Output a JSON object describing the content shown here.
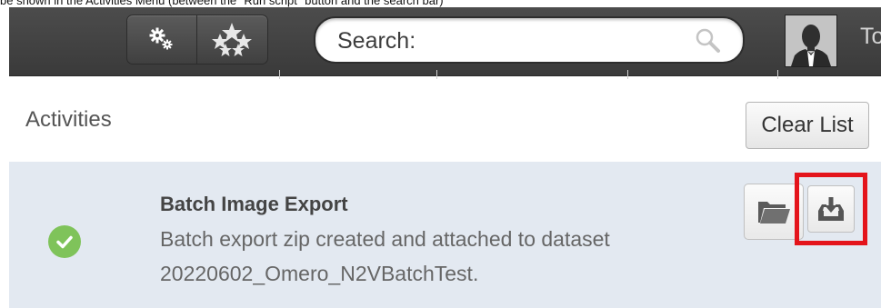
{
  "caption": "be shown in the Activities Menu (between the \"Run script\" button and the search bar)",
  "toolbar": {
    "settings_icon": "gears-icon",
    "scripts_icon": "stars-icon",
    "search": {
      "placeholder": "Search:",
      "value": "",
      "icon": "magnifier-icon"
    },
    "avatar_icon": "user-avatar-icon",
    "user_name": "To"
  },
  "activities": {
    "title": "Activities",
    "clear_label": "Clear List",
    "items": [
      {
        "title": "Batch Image Export",
        "description": "Batch export zip created and attached to dataset 20220602_Omero_N2VBatchTest.",
        "status": "success",
        "status_icon": "check-circle-icon",
        "actions": [
          "folder-icon",
          "download-icon"
        ]
      }
    ]
  },
  "colors": {
    "topbar": "#3f3f3f",
    "activity_row": "#e3e9f1",
    "success": "#7fc35a",
    "highlight": "#e4141b"
  }
}
